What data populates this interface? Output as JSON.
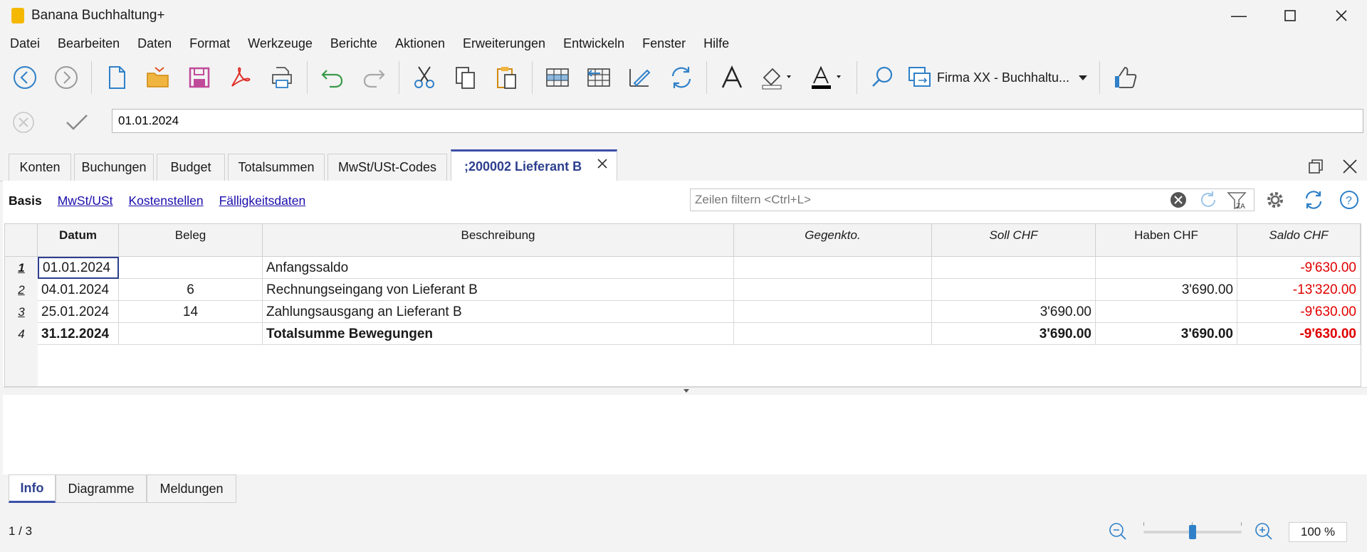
{
  "app": {
    "title": "Banana Buchhaltung+"
  },
  "menu": [
    "Datei",
    "Bearbeiten",
    "Daten",
    "Format",
    "Werkzeuge",
    "Berichte",
    "Aktionen",
    "Erweiterungen",
    "Entwickeln",
    "Fenster",
    "Hilfe"
  ],
  "toolbar": {
    "file_select": "Firma XX - Buchhaltu..."
  },
  "editbar": {
    "value": "01.01.2024"
  },
  "tabs": [
    "Konten",
    "Buchungen",
    "Budget",
    "Totalsummen",
    "MwSt/USt-Codes",
    ";200002 Lieferant B"
  ],
  "views": [
    "Basis",
    "MwSt/USt",
    "Kostenstellen",
    "Fälligkeitsdaten"
  ],
  "filter": {
    "placeholder": "Zeilen filtern <Ctrl+L>"
  },
  "columns": [
    "Datum",
    "Beleg",
    "Beschreibung",
    "Gegenkto.",
    "Soll CHF",
    "Haben CHF",
    "Saldo CHF"
  ],
  "rows": [
    {
      "num": "1",
      "datum": "01.01.2024",
      "beleg": "",
      "beschreibung": "Anfangssaldo",
      "gegenkto": "",
      "soll": "",
      "haben": "",
      "saldo": "-9'630.00"
    },
    {
      "num": "2",
      "datum": "04.01.2024",
      "beleg": "6",
      "beschreibung": "Rechnungseingang von Lieferant B",
      "gegenkto": "",
      "soll": "",
      "haben": "3'690.00",
      "saldo": "-13'320.00"
    },
    {
      "num": "3",
      "datum": "25.01.2024",
      "beleg": "14",
      "beschreibung": "Zahlungsausgang an Lieferant B",
      "gegenkto": "",
      "soll": "3'690.00",
      "haben": "",
      "saldo": "-9'630.00"
    },
    {
      "num": "4",
      "datum": "31.12.2024",
      "beleg": "",
      "beschreibung": "Totalsumme Bewegungen",
      "gegenkto": "",
      "soll": "3'690.00",
      "haben": "3'690.00",
      "saldo": "-9'630.00"
    }
  ],
  "bottom_tabs": [
    "Info",
    "Diagramme",
    "Meldungen"
  ],
  "status": {
    "record": "1 / 3",
    "zoom": "100 %",
    "zoom_level_percent": 100
  },
  "colors": {
    "accent": "#3b4fa8",
    "negative": "#e00000",
    "link": "#1a0dab"
  }
}
